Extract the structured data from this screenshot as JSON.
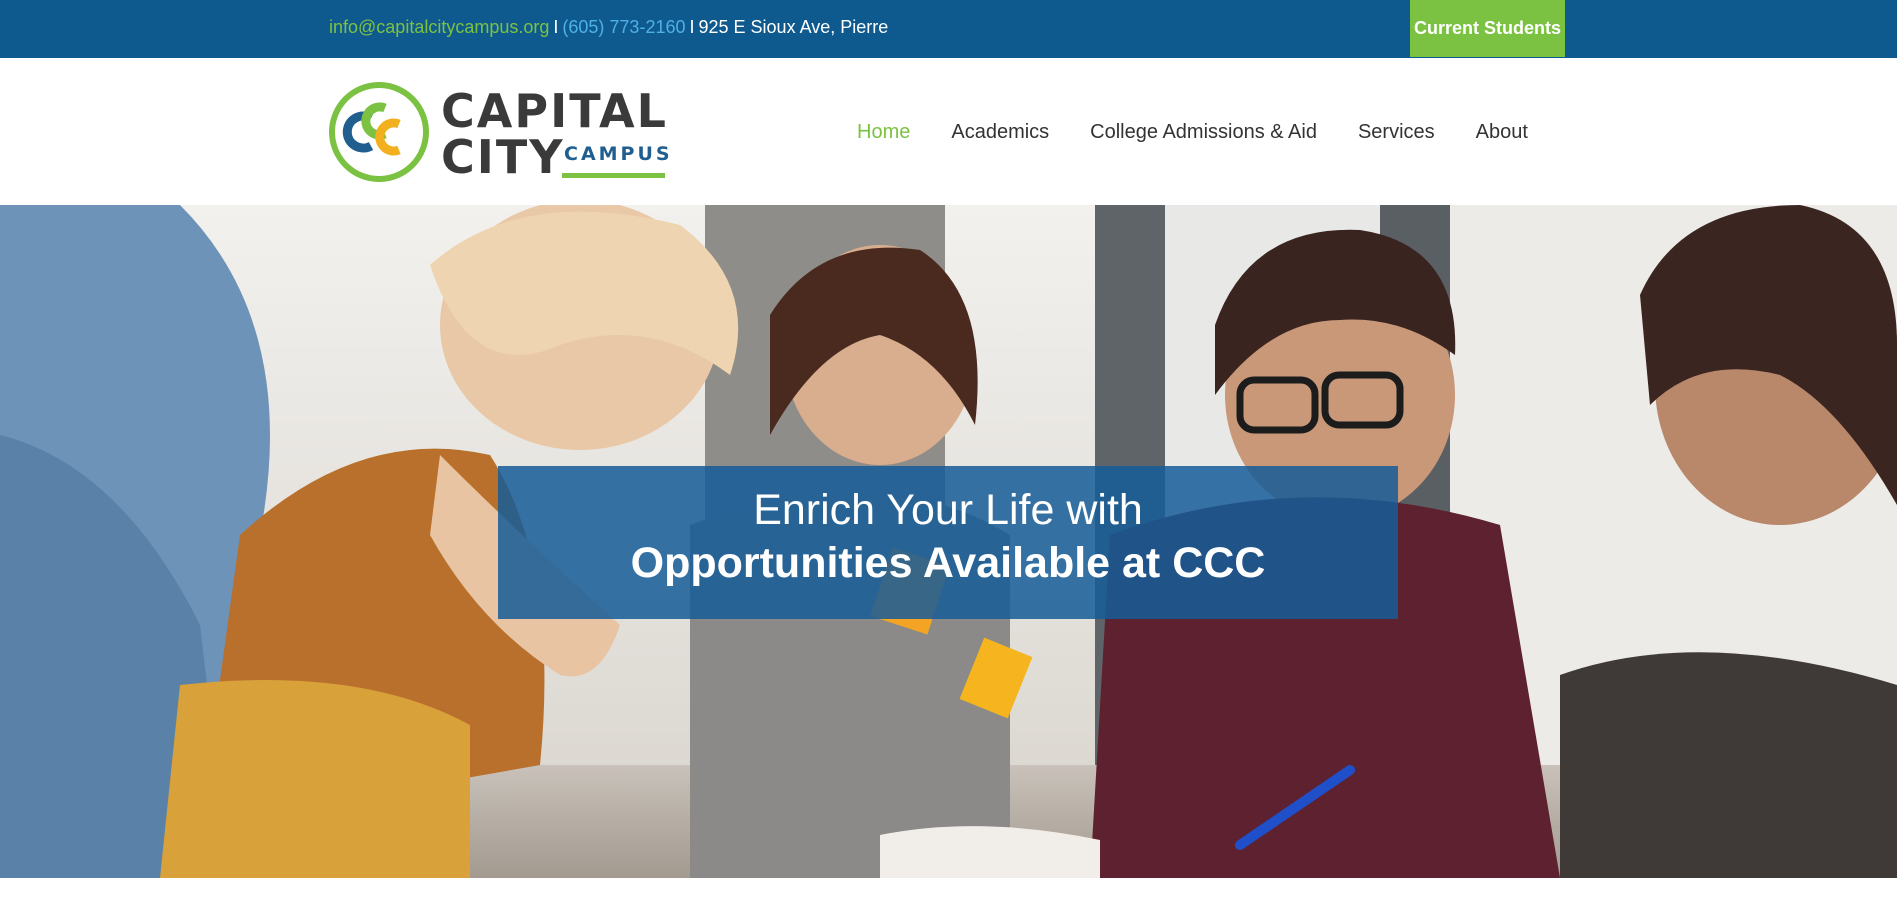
{
  "topbar": {
    "email": "info@capitalcitycampus.org",
    "separator": "I",
    "phone": "(605) 773-2160",
    "address": "925 E Sioux Ave, Pierre",
    "current_students_label": "Current Students"
  },
  "logo": {
    "line1": "CAPITAL",
    "line2": "CITY",
    "tagline": "CAMPUS"
  },
  "nav": {
    "items": [
      {
        "label": "Home",
        "active": true
      },
      {
        "label": "Academics",
        "active": false
      },
      {
        "label": "College Admissions & Aid",
        "active": false
      },
      {
        "label": "Services",
        "active": false
      },
      {
        "label": "About",
        "active": false
      }
    ]
  },
  "hero": {
    "line1": "Enrich Your Life with",
    "line2": "Opportunities Available at CCC"
  },
  "colors": {
    "brand_blue": "#0e5a8e",
    "brand_green": "#7cc242",
    "phone_blue": "#4fb0e6",
    "banner_blue": "#155c98",
    "text_dark": "#333333"
  }
}
